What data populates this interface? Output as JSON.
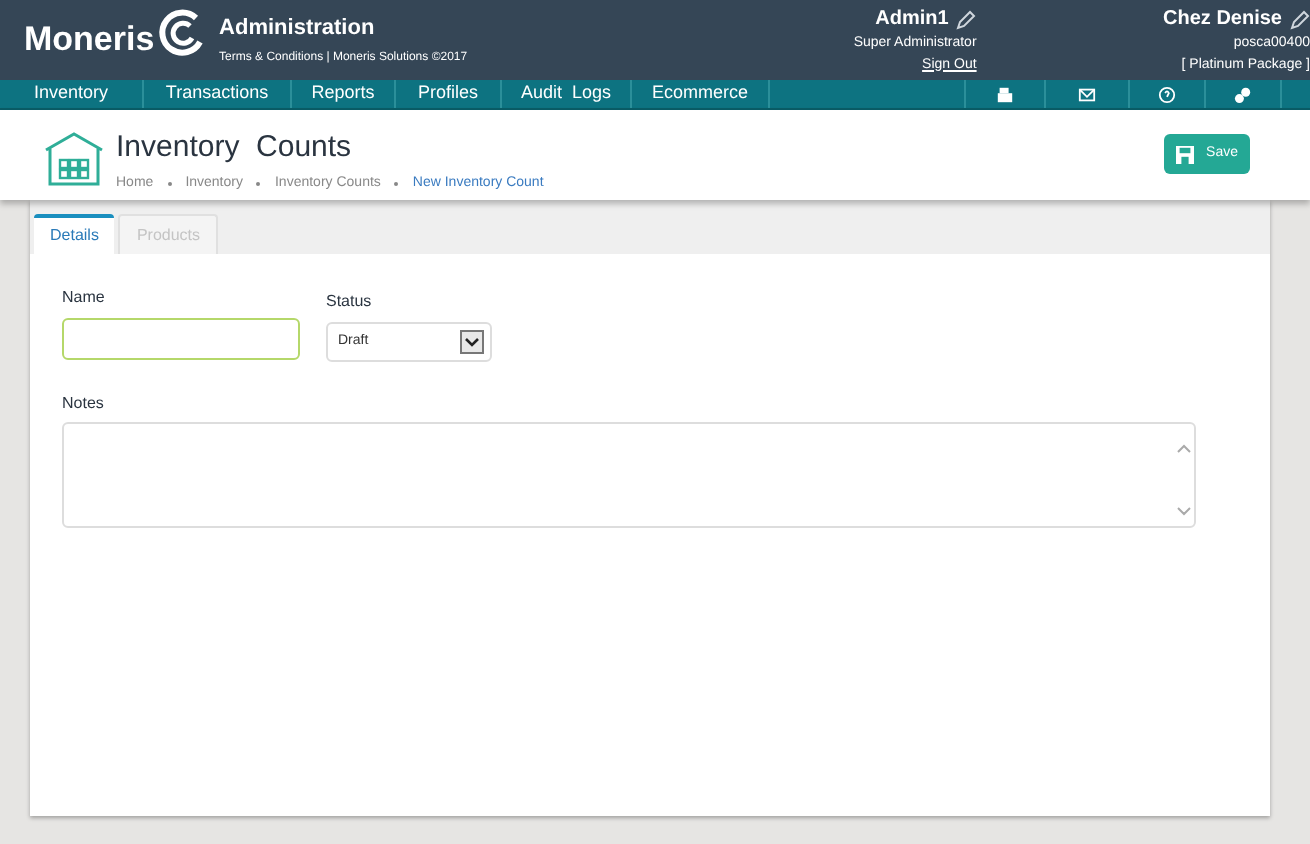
{
  "header": {
    "logo": "Moneris",
    "title": "Administration",
    "subtitle": "Terms & Conditions | Moneris Solutions ©2017",
    "user": {
      "name": "Admin1",
      "role": "Super Administrator",
      "link": "Sign Out"
    },
    "store": {
      "name": "Chez Denise",
      "id": "posca00400",
      "package": "[ Platinum Package ]"
    }
  },
  "nav": [
    {
      "label": "Inventory",
      "selected": false
    },
    {
      "label": "Transactions",
      "selected": false
    },
    {
      "label": "Reports",
      "selected": false
    },
    {
      "label": "Profiles",
      "selected": false
    },
    {
      "label": "Audit  Logs",
      "selected": false
    },
    {
      "label": "Ecommerce",
      "selected": false
    }
  ],
  "page": {
    "title": "Inventory  Counts",
    "breadcrumb": [
      {
        "label": "Home",
        "current": false
      },
      {
        "label": "Inventory",
        "current": false
      },
      {
        "label": "Inventory Counts",
        "current": false
      },
      {
        "label": "New Inventory Count",
        "current": true
      }
    ],
    "save": "Save"
  },
  "tabs": [
    {
      "label": "Details",
      "selected": true,
      "disabled": false
    },
    {
      "label": "Products",
      "selected": false,
      "disabled": true
    }
  ],
  "form": {
    "name_label": "Name",
    "status_label": "Status",
    "status_value": "Draft",
    "notes_label": "Notes"
  }
}
